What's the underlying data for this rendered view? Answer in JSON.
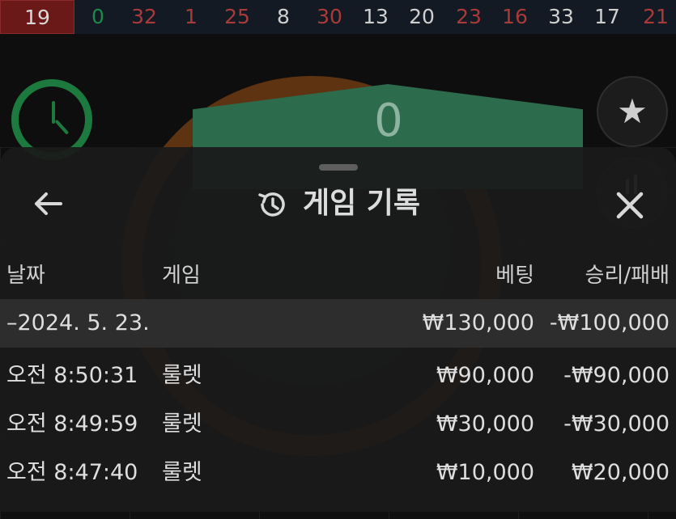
{
  "results_strip": {
    "numbers": [
      {
        "value": "19",
        "color": "red",
        "current": true
      },
      {
        "value": "0",
        "color": "green"
      },
      {
        "value": "32",
        "color": "red"
      },
      {
        "value": "1",
        "color": "red"
      },
      {
        "value": "25",
        "color": "red"
      },
      {
        "value": "8",
        "color": "black"
      },
      {
        "value": "30",
        "color": "red"
      },
      {
        "value": "13",
        "color": "black"
      },
      {
        "value": "20",
        "color": "black"
      },
      {
        "value": "23",
        "color": "red"
      },
      {
        "value": "16",
        "color": "red"
      },
      {
        "value": "33",
        "color": "black"
      },
      {
        "value": "17",
        "color": "black"
      },
      {
        "value": "21",
        "color": "red"
      }
    ]
  },
  "background": {
    "board_zero": "0"
  },
  "sheet": {
    "back_icon": "arrow-left-icon",
    "title_icon": "history-icon",
    "title": "게임 기록",
    "close_icon": "close-icon",
    "columns": {
      "date": "날짜",
      "game": "게임",
      "bet": "베팅",
      "win_loss": "승리/패배"
    },
    "date_group": {
      "date": "–2024. 5. 23.",
      "bet_total": "₩130,000",
      "win_total": "-₩100,000"
    },
    "rows": [
      {
        "time": "오전 8:50:31",
        "game": "룰렛",
        "bet": "₩90,000",
        "win": "-₩90,000"
      },
      {
        "time": "오전 8:49:59",
        "game": "룰렛",
        "bet": "₩30,000",
        "win": "-₩30,000"
      },
      {
        "time": "오전 8:47:40",
        "game": "룰렛",
        "bet": "₩10,000",
        "win": "₩20,000"
      }
    ]
  },
  "colors": {
    "accent_green": "#1d7a3f",
    "red_number": "#a83a3a",
    "sheet_bg": "#1a1a1a"
  }
}
